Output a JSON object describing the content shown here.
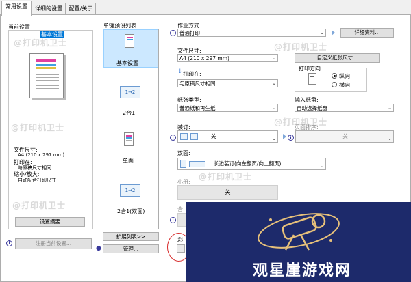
{
  "tabs": [
    {
      "label": "常用设置"
    },
    {
      "label": "详细的设置"
    },
    {
      "label": "配置/关于"
    }
  ],
  "left": {
    "current_settings_label": "当前设置",
    "preset_name": "基本设置",
    "file_size_label": "文件尺寸:",
    "file_size_value": "A4 (210 x 297 mm)",
    "print_on_label": "打印在:",
    "print_on_value": "与原稿尺寸相同",
    "zoom_label": "缩小/放大:",
    "zoom_value": "自动配合打印尺寸",
    "summary_button": "设置摘要",
    "register_button": "注册当前设置..."
  },
  "presets": {
    "label": "单键预设列表:",
    "items": [
      {
        "label": "基本设置"
      },
      {
        "label": "2合1"
      },
      {
        "label": "单面"
      },
      {
        "label": "2合1(双面)"
      }
    ],
    "badge": "1→2",
    "expand_button": "扩展列表>>",
    "manage_button": "管理..."
  },
  "job": {
    "label": "作业方式:",
    "value": "普通打印",
    "details_button": "详细资料..."
  },
  "file_size": {
    "label": "文件尺寸:",
    "value": "A4 (210 x 297 mm)",
    "custom_button": "自定义纸张尺寸..."
  },
  "print_on": {
    "label": "打印在:",
    "value": "与原稿尺寸相同"
  },
  "orientation": {
    "label": "打印方向",
    "portrait": "纵向",
    "landscape": "横向"
  },
  "paper_type": {
    "label": "纸张类型:",
    "value": "普通纸和再生纸"
  },
  "input_tray": {
    "label": "输入纸盘:",
    "value": "自动选择纸盘"
  },
  "duplex": {
    "label": "装订:",
    "value": "关"
  },
  "page_order": {
    "label": "页面排序:",
    "value": "关"
  },
  "double_side": {
    "label": "双面:",
    "value": "长边装订(向左翻页/向上翻页)"
  },
  "booklet": {
    "label": "小册:",
    "value": "关"
  },
  "partial": {
    "label1": "合",
    "label2": "彩"
  },
  "watermark": {
    "text": "@打印机卫士"
  },
  "overlay": {
    "title": "观星崖游戏网"
  },
  "colors": {
    "accent": "#0078d7",
    "overlay_bg": "#1d2a6b",
    "overlay_gold": "#e6c07a"
  }
}
